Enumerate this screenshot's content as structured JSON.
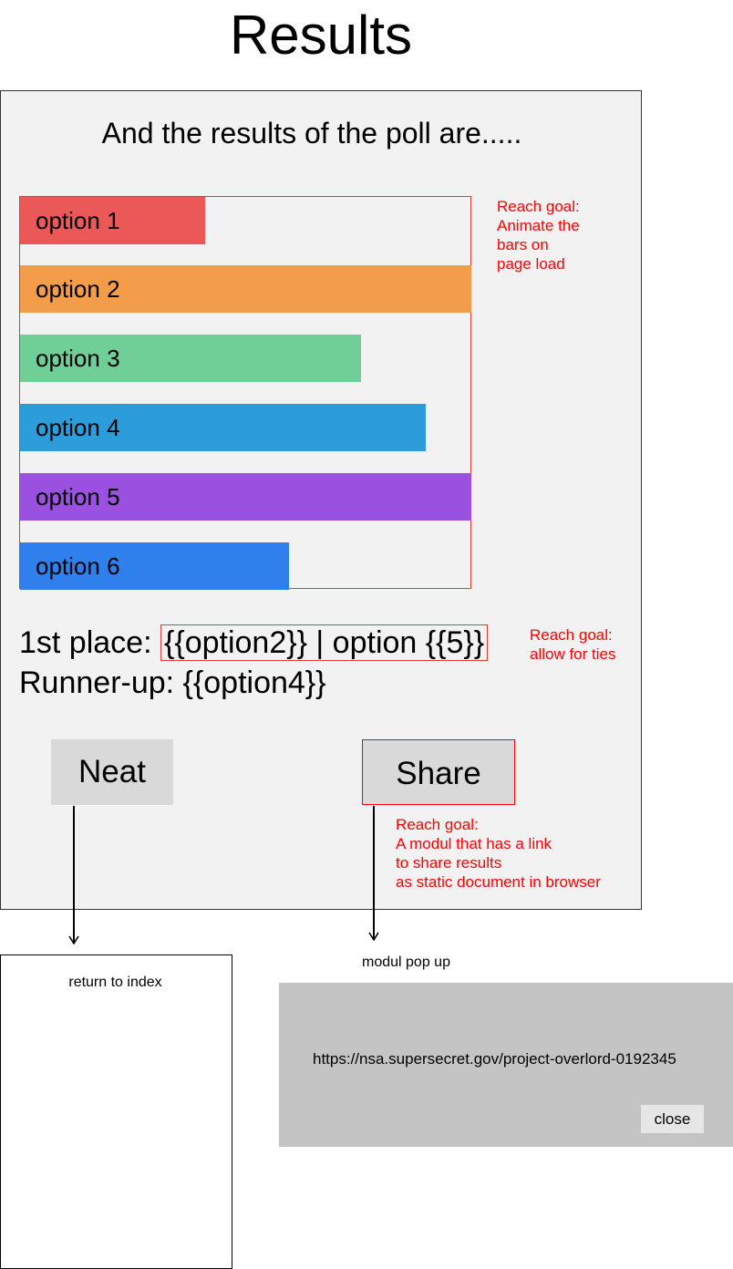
{
  "page": {
    "title": "Results"
  },
  "poll": {
    "headline": "And the results of the poll are.....",
    "options": [
      {
        "label": "option 1",
        "share": 0.41,
        "color": "#ea5858"
      },
      {
        "label": "option 2",
        "share": 1.0,
        "color": "#f39c4a"
      },
      {
        "label": "option 3",
        "share": 0.756,
        "color": "#6fcf97"
      },
      {
        "label": "option 4",
        "share": 0.899,
        "color": "#2d9cdb"
      },
      {
        "label": "option 5",
        "share": 1.0,
        "color": "#9b51e0"
      },
      {
        "label": "option 6",
        "share": 0.595,
        "color": "#2f80ed"
      }
    ],
    "animate_note": [
      "Reach goal:",
      "Animate the",
      "bars on",
      "page load"
    ]
  },
  "results": {
    "first_label": "1st place: ",
    "first_value": "{{option2}} | option {{5}}",
    "runner_label": "Runner-up: {{option4}}",
    "ties_note": [
      "Reach goal:",
      "allow for ties"
    ]
  },
  "actions": {
    "neat_label": "Neat",
    "share_label": "Share",
    "share_note": [
      "Reach goal:",
      "A modul that has a link",
      "to share results",
      "as static document in browser"
    ]
  },
  "index_page": {
    "label": "return to index"
  },
  "modal": {
    "caption": "modul pop up",
    "link": "https://nsa.supersecret.gov/project-overlord-0192345",
    "close_label": "close"
  },
  "colors": {
    "annotation": "#ff0000",
    "panel_bg": "#f2f2f2",
    "button_bg": "#d9d9d9",
    "modal_bg": "#c4c4c4"
  }
}
